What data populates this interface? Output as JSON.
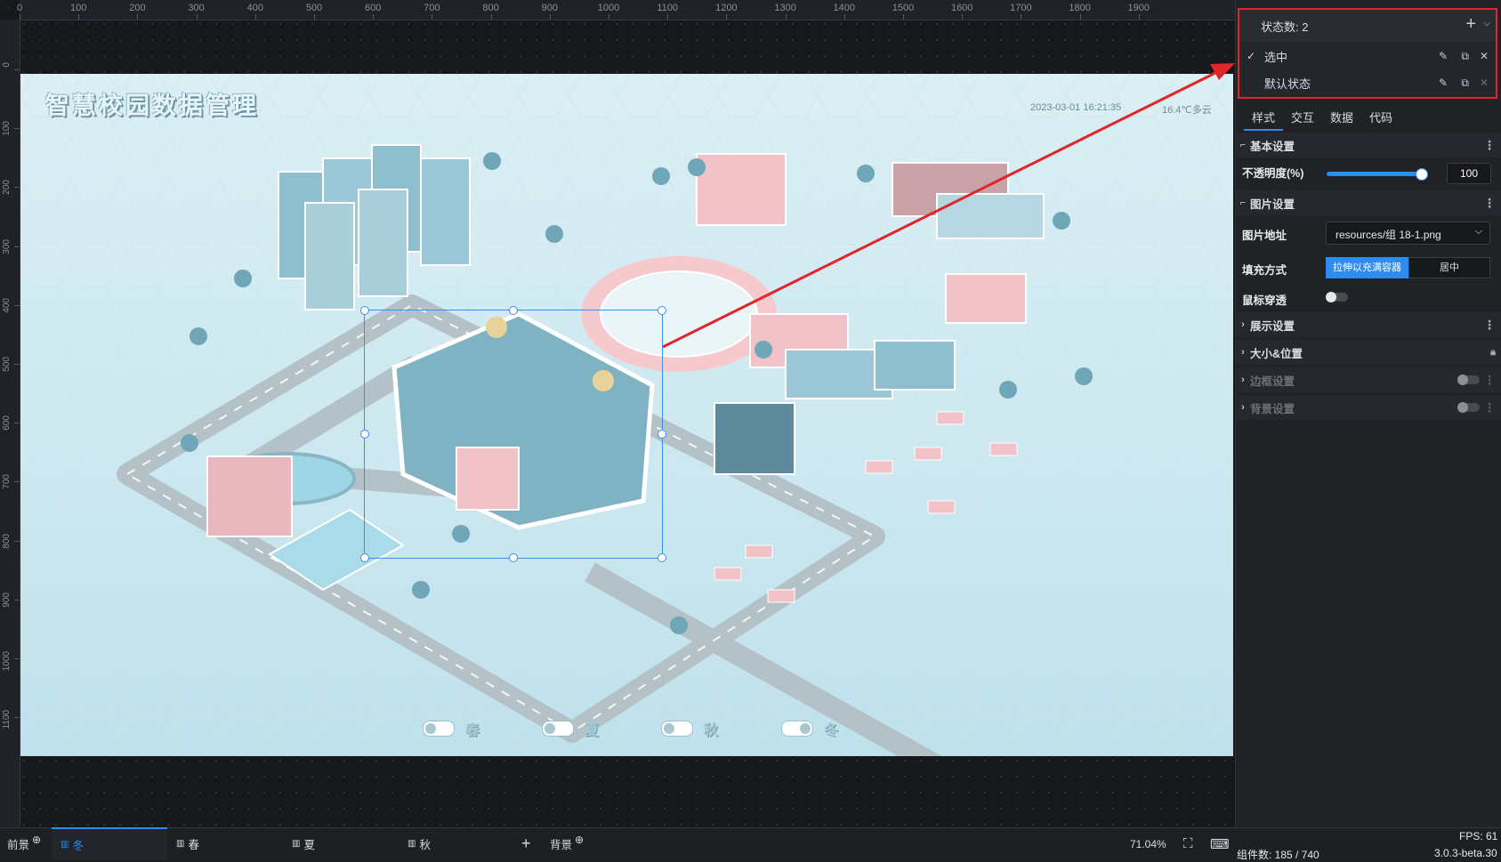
{
  "ruler": {
    "top": [
      "0",
      "100",
      "200",
      "300",
      "400",
      "500",
      "600",
      "700",
      "800",
      "900",
      "1000",
      "1100",
      "1200",
      "1300",
      "1400",
      "1500",
      "1600",
      "1700",
      "1800",
      "1900"
    ],
    "left": [
      "0",
      "100",
      "200",
      "300",
      "400",
      "500",
      "600",
      "700",
      "800",
      "900",
      "1000",
      "1100"
    ]
  },
  "canvas": {
    "title": "智慧校园数据管理",
    "datetime": "2023-03-01 16:21:35",
    "weather": "16.4℃多云",
    "seasons": [
      {
        "label": "春",
        "on": false
      },
      {
        "label": "夏",
        "on": false
      },
      {
        "label": "秋",
        "on": false
      },
      {
        "label": "冬",
        "on": true
      }
    ]
  },
  "states_panel": {
    "header": "状态数: 2",
    "states": [
      {
        "label": "选中",
        "checked": true
      },
      {
        "label": "默认状态",
        "checked": false
      }
    ]
  },
  "tabs": [
    "样式",
    "交互",
    "数据",
    "代码"
  ],
  "sections": {
    "basic": "基本设置",
    "image": "图片设置",
    "display": "展示设置",
    "size_pos": "大小&位置",
    "border": "边框设置",
    "background": "背景设置"
  },
  "fields": {
    "opacity_label": "不透明度(%)",
    "opacity_value": "100",
    "opacity_fraction": 1.0,
    "image_url_label": "图片地址",
    "image_url_value": "resources/组 18-1.png",
    "fill_mode_label": "填充方式",
    "fill_mode_options": [
      "拉伸以充满容器",
      "居中"
    ],
    "fill_mode_selected": "拉伸以充满容器",
    "mouse_through_label": "鼠标穿透"
  },
  "bottom": {
    "foreground": "前景",
    "background": "背景",
    "pages": [
      "冬",
      "春",
      "夏",
      "秋"
    ],
    "active_page": "冬",
    "zoom": "71.04%",
    "fps": "FPS: 61",
    "component_count": "组件数: 185 / 740",
    "version": "3.0.3-beta.30"
  },
  "colors": {
    "accent": "#2d8cf0",
    "highlight_red": "#e0262b",
    "panel_bg": "#202226",
    "canvas_bg": "#d3ebf2"
  }
}
